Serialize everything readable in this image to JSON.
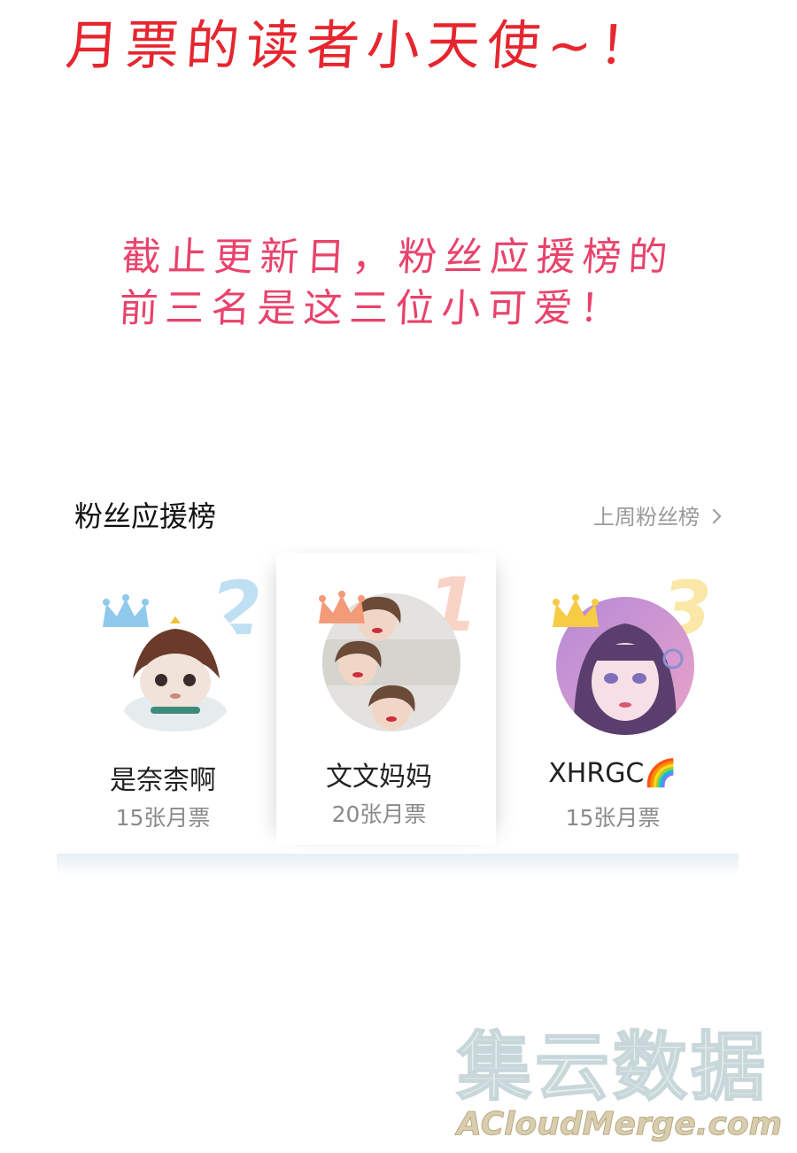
{
  "headline": "月票的读者小天使~！",
  "note": {
    "line1": "截止更新日，粉丝应援榜的",
    "line2": "前三名是这三位小可爱！"
  },
  "board": {
    "title": "粉丝应援榜",
    "link_label": "上周粉丝榜",
    "ranks": [
      {
        "rank": "2",
        "name": "是奈柰啊",
        "votes": "15张月票",
        "crown_color": "#8fc9ec",
        "num_color": "#bfe0f3"
      },
      {
        "rank": "1",
        "name": "文文妈妈",
        "votes": "20张月票",
        "crown_color": "#f39a78",
        "num_color": "#f9d3c6"
      },
      {
        "rank": "3",
        "name": "XHRGC🌈",
        "votes": "15张月票",
        "crown_color": "#f5cc43",
        "num_color": "#fbe8a8"
      }
    ]
  },
  "watermark": {
    "cn": "集云数据",
    "en": "ACloudMerge.com"
  },
  "colors": {
    "headline": "#e6262f",
    "note": "#e8436c"
  }
}
